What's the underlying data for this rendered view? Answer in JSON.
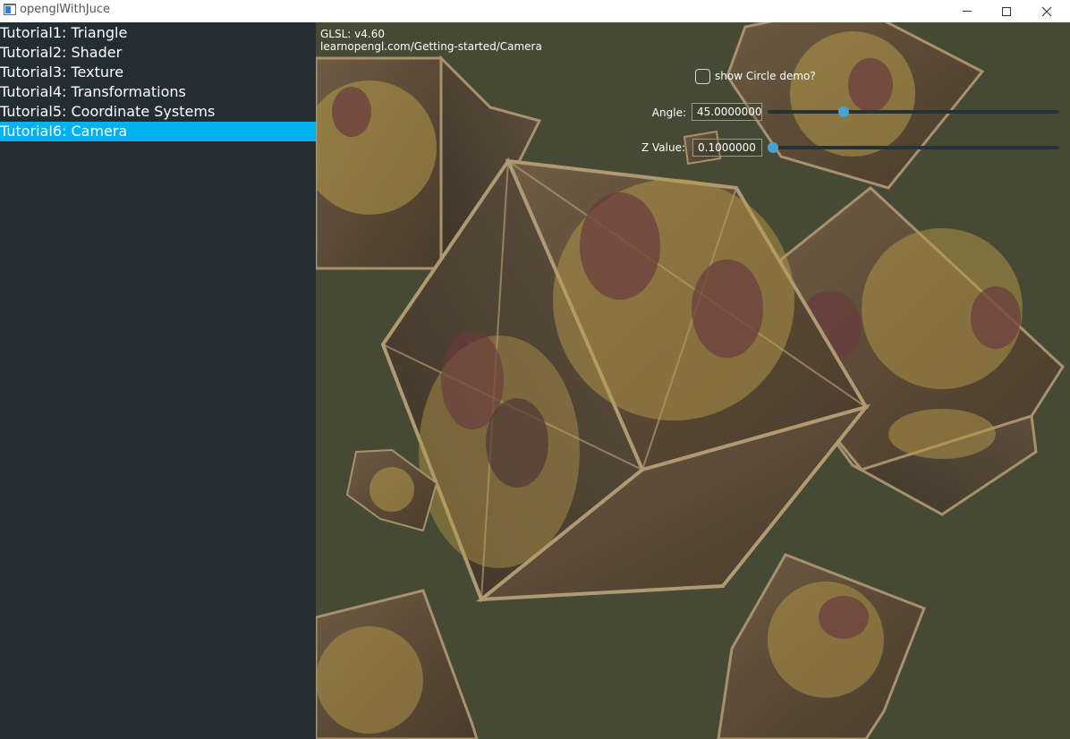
{
  "window": {
    "title": "openglWithJuce",
    "icon": "app-window-icon",
    "controls": [
      "minimize-icon",
      "maximize-icon",
      "close-icon"
    ]
  },
  "sidebar": {
    "items": [
      {
        "label": "Tutorial1: Triangle",
        "selected": false
      },
      {
        "label": "Tutorial2: Shader",
        "selected": false
      },
      {
        "label": "Tutorial3: Texture",
        "selected": false
      },
      {
        "label": "Tutorial4: Transformations",
        "selected": false
      },
      {
        "label": "Tutorial5: Coordinate Systems",
        "selected": false
      },
      {
        "label": "Tutorial6: Camera",
        "selected": true
      }
    ],
    "selected_color": "#00b2ee",
    "background_color": "#232e33"
  },
  "viewport": {
    "glsl_version": "GLSL: v4.60",
    "tutorial_url": "learnopengl.com/Getting-started/Camera",
    "background_color": "#464933",
    "circle_demo": {
      "label": "show Circle demo?",
      "checked": false
    },
    "angle": {
      "label": "Angle:",
      "value": "45.0000000",
      "fraction": 0.25
    },
    "z_value": {
      "label": "Z Value:",
      "value": "0.1000000",
      "fraction": 0.0
    },
    "slider_thumb_color": "#4aa3cc"
  }
}
